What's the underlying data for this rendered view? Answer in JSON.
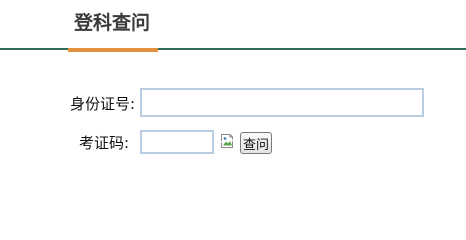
{
  "header": {
    "title": "登科查问"
  },
  "form": {
    "id_label": "身份证号:",
    "id_value": "",
    "ticket_label": "考证码:",
    "ticket_value": "",
    "captcha_icon": "broken-image-icon",
    "query_button": "查问"
  },
  "colors": {
    "header_line": "#2f6b57",
    "tab_accent": "#e3913d",
    "input_border": "#b8cde0"
  }
}
